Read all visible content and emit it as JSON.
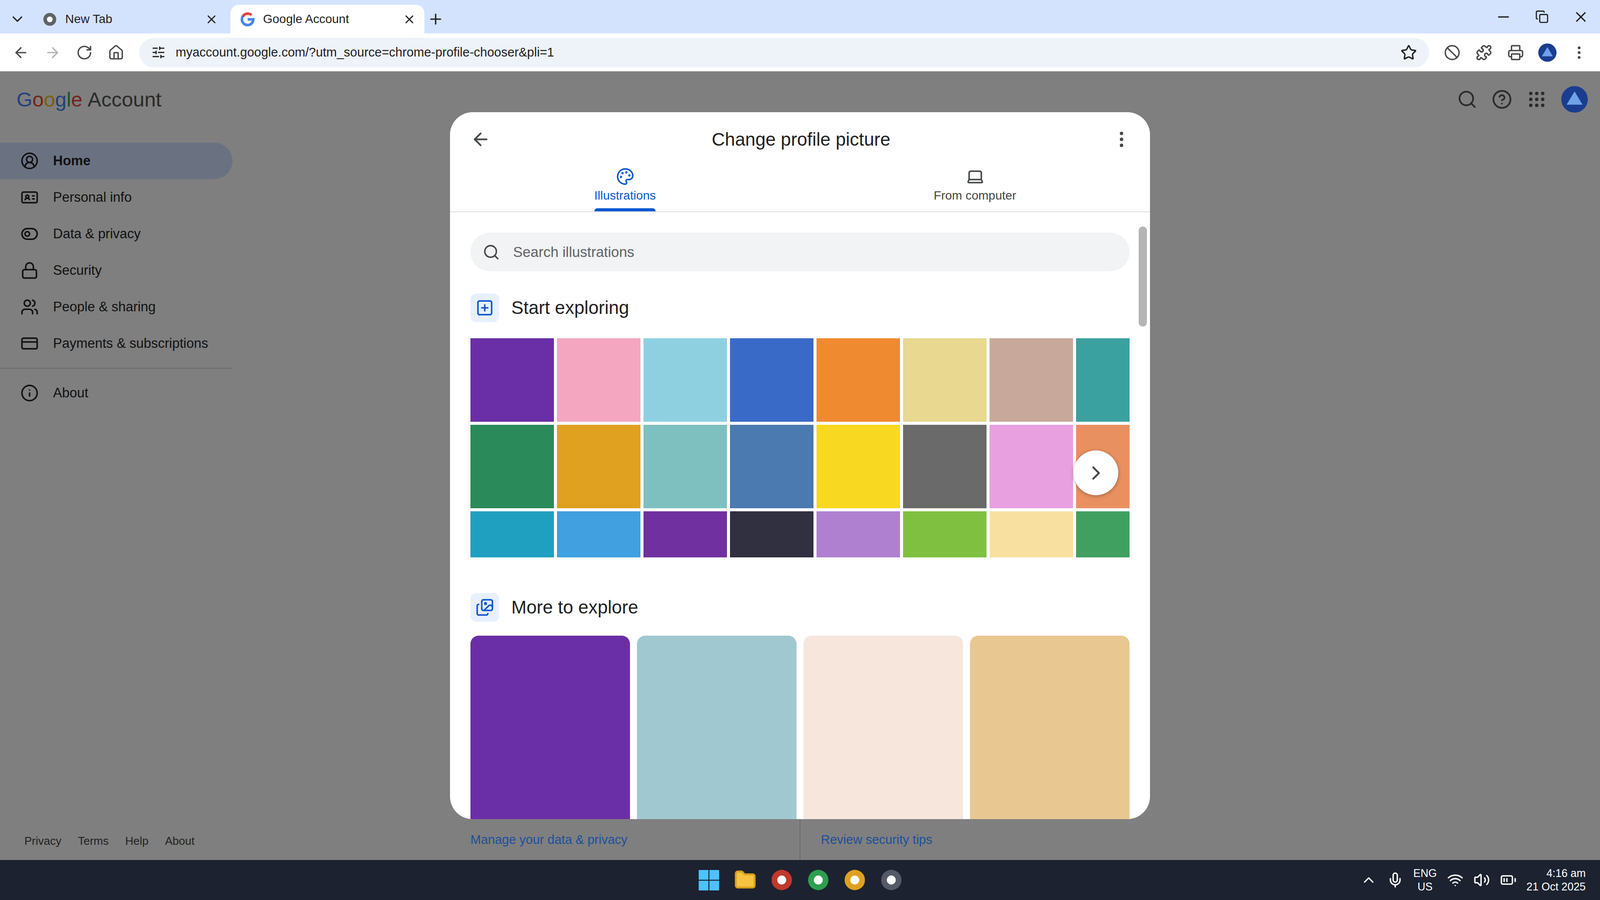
{
  "browser": {
    "tabs": [
      {
        "label": "New Tab",
        "selected": false
      },
      {
        "label": "Google Account",
        "selected": true
      }
    ],
    "address": "myaccount.google.com/?utm_source=chrome-profile-chooser&pli=1"
  },
  "header": {
    "logo": "Google",
    "title": "Account"
  },
  "sidebar": {
    "items": [
      {
        "label": "Home",
        "selected": true
      },
      {
        "label": "Personal info",
        "selected": false
      },
      {
        "label": "Data & privacy",
        "selected": false
      },
      {
        "label": "Security",
        "selected": false
      },
      {
        "label": "People & sharing",
        "selected": false
      },
      {
        "label": "Payments & subscriptions",
        "selected": false
      },
      {
        "label": "About",
        "selected": false
      }
    ]
  },
  "footer": [
    "Privacy",
    "Terms",
    "Help",
    "About"
  ],
  "background_links": [
    "Manage your data & privacy",
    "Review security tips"
  ],
  "dialog": {
    "title": "Change profile picture",
    "tabs": [
      {
        "label": "Illustrations",
        "selected": true
      },
      {
        "label": "From computer",
        "selected": false
      }
    ],
    "search": {
      "placeholder": "Search illustrations"
    },
    "sections": [
      {
        "title": "Start exploring",
        "tiles": [
          {
            "color": "#6a2fa6"
          },
          {
            "color": "#f4a6c0"
          },
          {
            "color": "#8fd0e0"
          },
          {
            "color": "#3a6ac8"
          },
          {
            "color": "#f08a30"
          },
          {
            "color": "#e8d890"
          },
          {
            "color": "#c8a89a"
          },
          {
            "color": "#3aa0a0"
          },
          {
            "color": "#2a8a5a"
          },
          {
            "color": "#e0a020"
          },
          {
            "color": "#7ec0c0"
          },
          {
            "color": "#4a7ab0"
          },
          {
            "color": "#f8d820"
          },
          {
            "color": "#6a6a6a"
          },
          {
            "color": "#e8a0e0"
          },
          {
            "color": "#e89060"
          },
          {
            "color": "#20a0c0"
          },
          {
            "color": "#40a0e0"
          },
          {
            "color": "#7030a0"
          },
          {
            "color": "#303040"
          },
          {
            "color": "#b080d0"
          },
          {
            "color": "#80c040"
          },
          {
            "color": "#f8e0a0"
          },
          {
            "color": "#40a060"
          }
        ]
      },
      {
        "title": "More to explore",
        "tiles": [
          {
            "color": "#6a2fa6"
          },
          {
            "color": "#a0c8d0"
          },
          {
            "color": "#f6e6dc"
          },
          {
            "color": "#e8c890"
          }
        ]
      }
    ]
  },
  "taskbar": {
    "language": "ENG",
    "region": "US",
    "time": "4:16 am",
    "date": "21 Oct 2025"
  }
}
